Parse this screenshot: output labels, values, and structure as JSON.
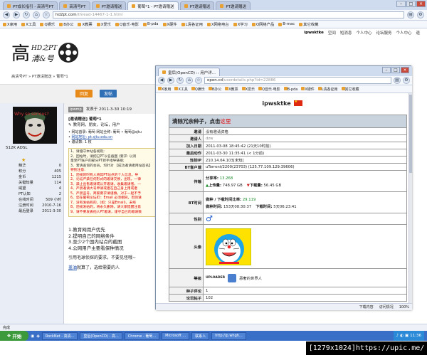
{
  "outer": {
    "tabs": [
      "PT成长指引 - 高清号PT",
      "高清号PT",
      "PT邀请赠送",
      "葡萄*1 - PT邀请赠送",
      "PT邀请赠送",
      "PT邀请赠送"
    ],
    "url_host": "hd2pt.com",
    "url_path": "/thread-14467-1-1.html",
    "bookmarks": [
      "X家用",
      "X工具",
      "Q娱乐",
      "B办公",
      "X教票",
      "X爱乐",
      "Q音乐·电影",
      "B-pda",
      "X硬件",
      "L清各证用",
      "X网络电台",
      "X学习",
      "Q网络产品",
      "B-mac",
      "其它收藏"
    ],
    "top_links": {
      "user": "ipwsktke",
      "links": [
        "空间",
        "短消息",
        "个人中心",
        "论坛服务",
        "个人中心",
        "退"
      ]
    },
    "breadcrumb": "高清号PT » PT邀请赠送 » 葡萄*1",
    "btn_reply": "回复",
    "btn_post": "发帖",
    "user": {
      "name": "ipwmp",
      "title": "512K ADSL",
      "stats": [
        [
          "精华",
          "0"
        ],
        [
          "积分",
          "405"
        ],
        [
          "金币",
          "1215"
        ],
        [
          "关键知量",
          "114"
        ],
        [
          "威望",
          "4"
        ],
        [
          "PT认知",
          "2"
        ],
        [
          "在线时间",
          "509 小时"
        ],
        [
          "注册时间",
          "2010-7-16"
        ],
        [
          "最后登录",
          "2011-3-30"
        ]
      ]
    },
    "post": {
      "time": "发表于 2011-3-30 10:19",
      "tag": "[邀请赠送] 葡萄*1",
      "category": "教育网，朋友，论坛，用户",
      "lines": [
        "网站首录: 葡萄 网站全称: 葡萄 • 葡萄@sjtu",
        "网站地址: pt.sjtu.edu.cn",
        "邀请数: 1 枚"
      ],
      "box_lines": [
        "1、请遵守本站各规则;",
        "2、回帖时，请把已PT以名截图 (要求: 以测",
        "量至PT账户的部分PT新手指导链接;",
        "3、若请查询的会员，均针对 【成功邀请者用站签名】",
        "特别注意:",
        "1、违规的时有人将其PT站点的个人信息，导",
        "2、论坛严禁任何形式的邀请交换，出现，一律",
        "3、禁止出售邀请或公开邀请，收集邀请者，一",
        "4、严禁邀请大号申请或者在自己身上用或者",
        "5、严禁盗号，商家要求请谨慎，对于一起不予",
        "6、您在葡萄论坛ID：Email 必须相同，否则请",
        "7、没有发帖有的，(如：只是Email)，未经",
        "8、违规发帖的，将永久删除，请大家提醒注意",
        "9、请不要发表他人PT邀请，谨守自己的邀请数"
      ],
      "list": [
        "1.教育网用户优先",
        "2.提明自己的网络条件",
        "3.至少2个国内站点的截图",
        "4.公网用户主要看保种情况"
      ],
      "foot1": "引用毛球侦探的要求，不要见怪哦~",
      "foot2_link": "盖油",
      "foot2": "就算了，选给需要的人"
    },
    "status": "完成"
  },
  "popup": {
    "tab": "皇后(OpenCD) :: 用户详...",
    "url_host": "open.cd",
    "url_path": "/userdetails.php?id=22886",
    "bookmarks": [
      "X家用",
      "X工具",
      "Q娱乐",
      "B办公",
      "X教票",
      "X爱乐",
      "Q音乐·电影",
      "B-pda",
      "X硬件",
      "L清各证用",
      "其它收藏"
    ],
    "username": "ipwsktke",
    "table_title": "清除冗余种子，点击",
    "table_title_link": "这里",
    "rows": [
      {
        "k": "邀请",
        "v": "没有邀请资格"
      },
      {
        "k": "邀请人",
        "v": "dzw",
        "cls": "gray"
      },
      {
        "k": "加入日期",
        "v": "2011-03-08 18:45:42 (21天10时前)"
      },
      {
        "k": "最后动作",
        "v": "2011-03-30 11:35:41 (< 1分前)"
      },
      {
        "k": "当前IP",
        "v": "210.14.64.103[未知]"
      },
      {
        "k": "BT客户端",
        "v": "uTorrent/2200(23703) (125.77.109.129:39606)"
      }
    ],
    "transfer": {
      "k": "传输",
      "share_label": "分享率:",
      "share": "13.268",
      "up_label": "上传量:",
      "up": "748.97 GB",
      "down_label": "下载量:",
      "down": "56.45 GB"
    },
    "bttime": {
      "k": "BT时间",
      "ratio_label": "做种 / 下载时间比率:",
      "ratio": "29.119",
      "seed_label": "做种时间:",
      "seed": "153天08:30:37",
      "dl_label": "下载时间:",
      "dl": "5天06:23:41"
    },
    "gender": {
      "k": "性别",
      "icon": "♂"
    },
    "avatar_k": "头像",
    "level": {
      "k": "等级",
      "badge": "UPLOADER",
      "text": "恶奢的世界人"
    },
    "seed_comment": {
      "k": "种子评论",
      "v": "1"
    },
    "forum_posts": {
      "k": "论坛帖子",
      "v": "102"
    },
    "status_links": [
      "下载内容",
      "访问情况",
      "100%"
    ]
  },
  "taskbar": {
    "start": "开始",
    "items": [
      "RockNet - 高清...",
      "皇后(OpenCD) - 高...",
      "Chrome - 葡萄...",
      "Microsoft ...",
      "联系人",
      "http://p.whgh..."
    ],
    "clock": "11:36"
  },
  "watermark": "[1279x1024]https://upic.me/"
}
